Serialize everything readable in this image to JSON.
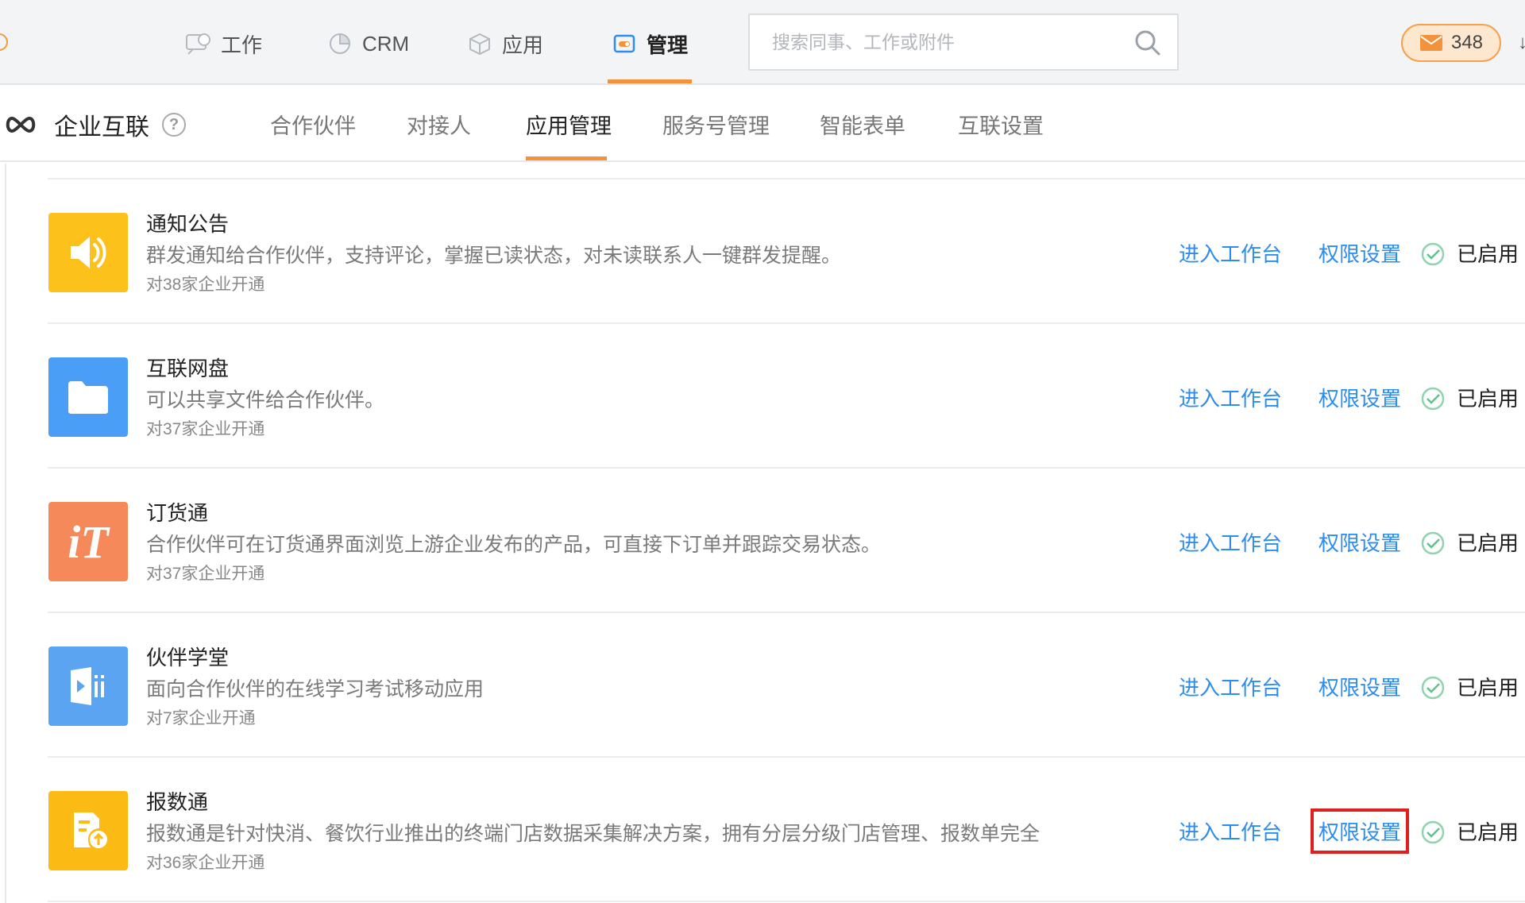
{
  "topnav": {
    "items": [
      {
        "label": "工作",
        "icon": "work-bubble-icon"
      },
      {
        "label": "CRM",
        "icon": "crm-pie-icon"
      },
      {
        "label": "应用",
        "icon": "apps-cube-icon"
      },
      {
        "label": "管理",
        "icon": "manage-toggle-icon",
        "active": true
      }
    ],
    "search_placeholder": "搜索同事、工作或附件",
    "message_count": "348"
  },
  "subheader": {
    "title": "企业互联",
    "help_glyph": "?",
    "tabs": [
      "合作伙伴",
      "对接人",
      "应用管理",
      "服务号管理",
      "智能表单",
      "互联设置"
    ],
    "active_tab": "应用管理"
  },
  "apps": [
    {
      "name": "通知公告",
      "desc": "群发通知给合作伙伴，支持评论，掌握已读状态，对未读联系人一键群发提醒。",
      "count": "对38家企业开通",
      "icon": "speaker-icon",
      "color": "#fcc21b",
      "enter_label": "进入工作台",
      "perm_label": "权限设置",
      "status": "已启用"
    },
    {
      "name": "互联网盘",
      "desc": "可以共享文件给合作伙伴。",
      "count": "对37家企业开通",
      "icon": "folder-icon",
      "color": "#4a9ef5",
      "enter_label": "进入工作台",
      "perm_label": "权限设置",
      "status": "已启用"
    },
    {
      "name": "订货通",
      "desc": "合作伙伴可在订货通界面浏览上游企业发布的产品，可直接下订单并跟踪交易状态。",
      "count": "对37家企业开通",
      "icon": "it-logo-icon",
      "icon_text": "iT",
      "color": "#f5895a",
      "enter_label": "进入工作台",
      "perm_label": "权限设置",
      "status": "已启用"
    },
    {
      "name": "伙伴学堂",
      "desc": "面向合作伙伴的在线学习考试移动应用",
      "count": "对7家企业开通",
      "icon": "video-course-icon",
      "color": "#5aa4f2",
      "enter_label": "进入工作台",
      "perm_label": "权限设置",
      "status": "已启用"
    },
    {
      "name": "报数通",
      "desc": "报数通是针对快消、餐饮行业推出的终端门店数据采集解决方案，拥有分层分级门店管理、报数单完全",
      "count": "对36家企业开通",
      "icon": "report-upload-icon",
      "color": "#fbbb14",
      "enter_label": "进入工作台",
      "perm_label": "权限设置",
      "status": "已启用",
      "perm_highlighted": true
    }
  ],
  "colors": {
    "accent_orange": "#f3923b",
    "link_blue": "#2d8cf0",
    "highlight_red": "#e0201c",
    "status_green": "#5bc48a"
  }
}
